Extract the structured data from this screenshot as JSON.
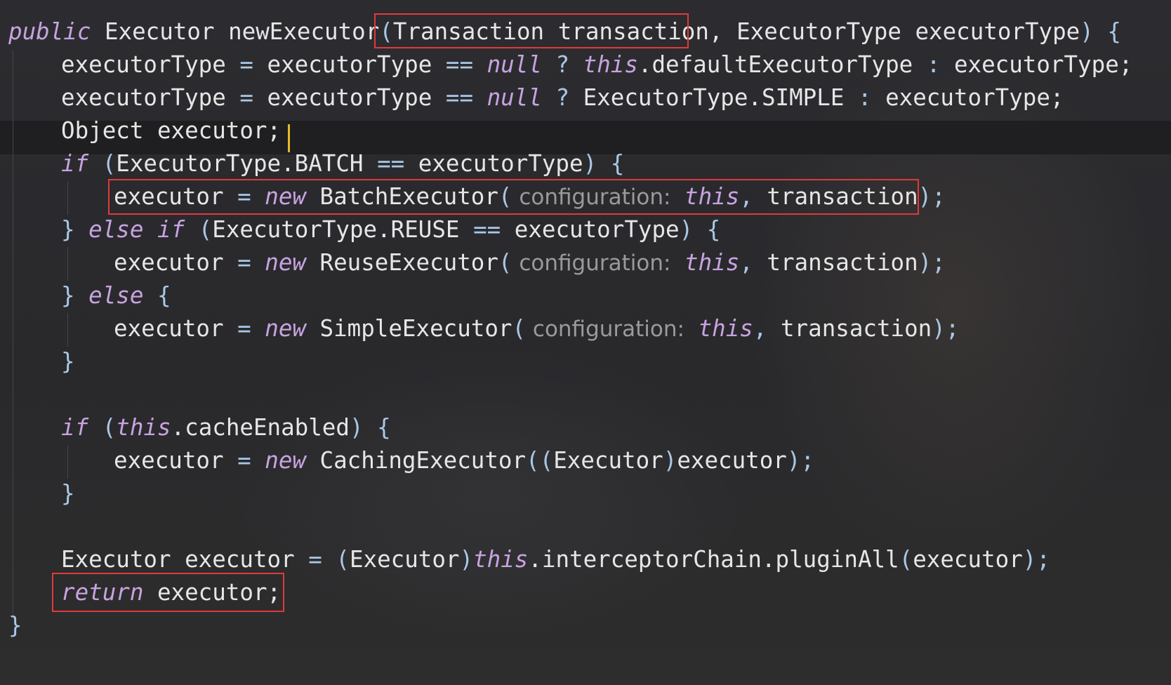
{
  "code": {
    "l1": {
      "kw_public": "public",
      "sig_a": " Executor newExecutor",
      "p_open": "(",
      "param": "Transaction transaction",
      "comma": ",",
      "sig_b": " ExecutorType executorType",
      "p_close": ")",
      "brace": " {"
    },
    "l2": {
      "a": "executorType ",
      "eq": "=",
      "b": " executorType ",
      "eqeq": "==",
      "c": " ",
      "kw_null": "null",
      "d": " ",
      "q": "?",
      "e": " ",
      "kw_this": "this",
      "f": ".defaultExecutorType ",
      "colon": ":",
      "g": " executorType;"
    },
    "l3": {
      "a": "executorType ",
      "eq": "=",
      "b": " executorType ",
      "eqeq": "==",
      "c": " ",
      "kw_null": "null",
      "d": " ",
      "q": "?",
      "e": " ExecutorType.SIMPLE ",
      "colon": ":",
      "f": " executorType;"
    },
    "l4": {
      "text": "Object executor;"
    },
    "l5": {
      "kw_if": "if",
      "p_open": " (",
      "a": "ExecutorType.BATCH ",
      "eqeq": "==",
      "b": " executorType",
      "p_close": ")",
      "brace": " {"
    },
    "l6": {
      "a": "executor ",
      "eq": "=",
      "sp": " ",
      "kw_new": "new",
      "b": " BatchExecutor",
      "p_open": "(",
      "hint": " configuration:",
      "sp2": " ",
      "kw_this": "this",
      "comma": ",",
      "c": " transaction",
      "p_close": ")",
      "semi": ";"
    },
    "l7": {
      "brace": "}",
      "sp": " ",
      "kw_else": "else",
      "sp2": " ",
      "kw_if": "if",
      "p_open": " (",
      "a": "ExecutorType.REUSE ",
      "eqeq": "==",
      "b": " executorType",
      "p_close": ")",
      "brace2": " {"
    },
    "l8": {
      "a": "executor ",
      "eq": "=",
      "sp": " ",
      "kw_new": "new",
      "b": " ReuseExecutor",
      "p_open": "(",
      "hint": " configuration:",
      "sp2": " ",
      "kw_this": "this",
      "comma": ",",
      "c": " transaction",
      "p_close": ")",
      "semi": ";"
    },
    "l9": {
      "brace": "}",
      "sp": " ",
      "kw_else": "else",
      "brace2": " {"
    },
    "l10": {
      "a": "executor ",
      "eq": "=",
      "sp": " ",
      "kw_new": "new",
      "b": " SimpleExecutor",
      "p_open": "(",
      "hint": " configuration:",
      "sp2": " ",
      "kw_this": "this",
      "comma": ",",
      "c": " transaction",
      "p_close": ")",
      "semi": ";"
    },
    "l11": {
      "brace": "}"
    },
    "l12": {
      "kw_if": "if",
      "p_open": " (",
      "kw_this": "this",
      "a": ".cacheEnabled",
      "p_close": ")",
      "brace": " {"
    },
    "l13": {
      "a": "executor ",
      "eq": "=",
      "sp": " ",
      "kw_new": "new",
      "b": " CachingExecutor",
      "p_open": "((",
      "c": "Executor",
      "p_mid": ")",
      "d": "executor",
      "p_close": ")",
      "semi": ";"
    },
    "l14": {
      "brace": "}"
    },
    "l15": {
      "a": "Executor executor ",
      "eq": "=",
      "sp": " ",
      "p_open": "(",
      "b": "Executor",
      "p_mid": ")",
      "kw_this": "this",
      "c": ".interceptorChain.pluginAll",
      "p_open2": "(",
      "d": "executor",
      "p_close": ")",
      "semi": ";"
    },
    "l16": {
      "kw_return": "return",
      "a": " executor;"
    },
    "l17": {
      "brace": "}"
    }
  }
}
